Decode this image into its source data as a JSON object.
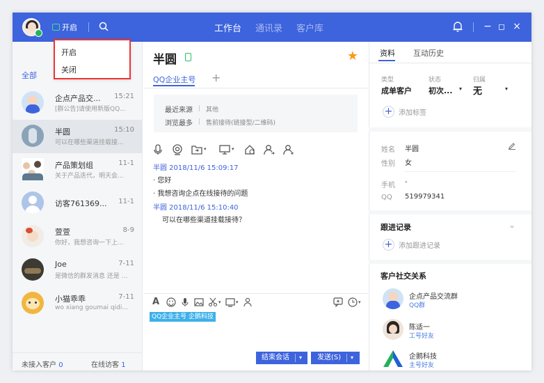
{
  "colors": {
    "brand": "#3d63dd",
    "online": "#23b35c",
    "star": "#f79a1e",
    "highlight_border": "#e33333"
  },
  "topbar": {
    "status_label": "开启",
    "tabs": [
      {
        "label": "工作台",
        "active": true
      },
      {
        "label": "通讯录",
        "active": false
      },
      {
        "label": "客户库",
        "active": false
      }
    ],
    "win_min": "−",
    "win_max": "◻",
    "win_close": "×"
  },
  "status_menu": {
    "items": [
      "开启",
      "关闭"
    ]
  },
  "sidebar": {
    "filter": "全部",
    "contacts": [
      {
        "name": "企点产品交...",
        "time": "15:21",
        "msg": "[群公告]请使用新版QQ...",
        "avatar": "group-avatar"
      },
      {
        "name": "半圆",
        "time": "15:10",
        "msg": "可以在哪些渠道挂载接...",
        "avatar": "user-avatar",
        "selected": true
      },
      {
        "name": "产品策划组",
        "time": "11-1",
        "msg": "关于产品迭代，明天会...",
        "avatar": "group-avatar"
      },
      {
        "name": "访客761369...",
        "time": "11-1",
        "msg": "",
        "avatar": "visitor-avatar"
      },
      {
        "name": "萱萱",
        "time": "8-9",
        "msg": "你好，我想咨询一下上...",
        "avatar": "user-avatar"
      },
      {
        "name": "Joe",
        "time": "7-11",
        "msg": "是微信的群发消息 还是 ...",
        "avatar": "user-avatar"
      },
      {
        "name": "小猫乖乖",
        "time": "7-11",
        "msg": "wo xiang goumai qidi...",
        "avatar": "user-avatar"
      }
    ],
    "footer": {
      "pending_label": "未接入客户",
      "pending_count": "0",
      "online_label": "在线访客",
      "online_count": "1"
    }
  },
  "chat": {
    "name": "半圆",
    "tab": "QQ企业主号",
    "add_tab": "+",
    "info": [
      {
        "label": "最近来源",
        "value": "其他"
      },
      {
        "label": "浏览最多",
        "value": "售前接待(链接型/二维码)"
      }
    ],
    "messages": [
      {
        "header": "半圆 2018/11/6 15:09:17",
        "lines": [
          "· 您好",
          "· 我想咨询企点在线接待的问题"
        ]
      },
      {
        "header": "半圆 2018/11/6 15:10:40",
        "lines": [
          "可以在哪些渠道挂载接待？"
        ]
      }
    ],
    "compose_tag": "QQ企业主号 企鹅科技",
    "end_button": "结束会话",
    "send_button": "发送(S)"
  },
  "right": {
    "tabs": [
      "资料",
      "互动历史"
    ],
    "type_label": "类型",
    "type_value": "成单客户",
    "state_label": "状态",
    "state_value": "初次...",
    "owner_label": "归属",
    "owner_value": "无",
    "add_tag": "添加标签",
    "name_label": "姓名",
    "name_value": "半圆",
    "gender_label": "性别",
    "gender_value": "女",
    "phone_label": "手机",
    "phone_value": "-",
    "qq_label": "QQ",
    "qq_value": "519979341",
    "followup_title": "跟进记录",
    "add_followup": "添加跟进记录",
    "social_title": "客户社交关系",
    "social": [
      {
        "name": "企点产品交流群",
        "sub": "QQ群"
      },
      {
        "name": "陈适一",
        "sub": "工号好友"
      },
      {
        "name": "企鹅科技",
        "sub": "主号好友"
      }
    ]
  }
}
